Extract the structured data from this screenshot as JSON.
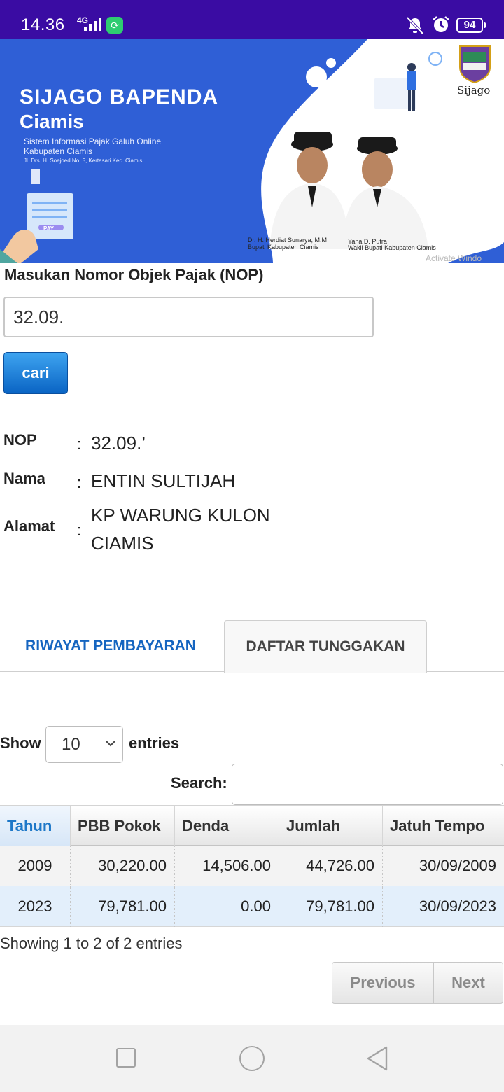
{
  "status_bar": {
    "time": "14.36",
    "network": "4G",
    "battery": "94"
  },
  "banner": {
    "title": "SIJAGO BAPENDA",
    "subtitle": "Ciamis",
    "description_line1": "Sistem Informasi Pajak Galuh Online",
    "description_line2": "Kabupaten Ciamis",
    "address": "Jl. Drs. H. Soejoed No. 5, Kertasari Kec. Ciamis",
    "pay_label": "PAY",
    "brand": "Sijago",
    "person1_name": "Dr. H. Herdiat Sunarya, M.M",
    "person1_title": "Bupati Kabupaten Ciamis",
    "person2_name": "Yana D. Putra",
    "person2_title": "Wakil Bupati Kabupaten Ciamis",
    "watermark": "Activate Windo"
  },
  "form": {
    "label": "Masukan Nomor Objek Pajak (NOP)",
    "nop_value": "32.09.",
    "search_button": "cari"
  },
  "info": {
    "nop_label": "NOP",
    "nop_value": "32.09.’",
    "nama_label": "Nama",
    "nama_value": "ENTIN SULTIJAH",
    "alamat_label": "Alamat",
    "alamat_line1": "KP WARUNG KULON",
    "alamat_line2": "CIAMIS",
    "colon": ":"
  },
  "tabs": {
    "tab1": "RIWAYAT PEMBAYARAN",
    "tab2": "DAFTAR TUNGGAKAN",
    "active": "DAFTAR TUNGGAKAN"
  },
  "table_controls": {
    "show_label": "Show",
    "entries_value": "10",
    "entries_label": "entries",
    "search_label": "Search:",
    "search_value": ""
  },
  "table": {
    "headers": [
      "Tahun",
      "PBB Pokok",
      "Denda",
      "Jumlah",
      "Jatuh Tempo"
    ],
    "rows": [
      [
        "2009",
        "30,220.00",
        "14,506.00",
        "44,726.00",
        "30/09/2009"
      ],
      [
        "2023",
        "79,781.00",
        "0.00",
        "79,781.00",
        "30/09/2023"
      ]
    ]
  },
  "footer": {
    "info": "Showing 1 to 2 of 2 entries",
    "previous": "Previous",
    "next": "Next"
  },
  "colors": {
    "status_bar": "#3a0ca3",
    "banner_blue": "#2f5fd6",
    "link_blue": "#1565c0",
    "button_blue": "#0a64c4"
  }
}
